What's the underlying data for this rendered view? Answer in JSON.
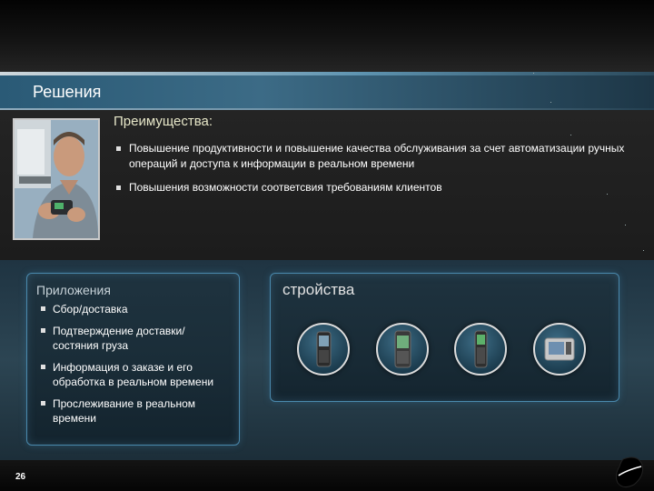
{
  "title": "Решения",
  "advantages": {
    "heading": "Преимущества:",
    "items": [
      "Повышение продуктивности и повышение качества обслуживания за счет автоматизации ручных операций и доступа к информации в реальном времени",
      "Повышения возможности соответсвия требованиям клиентов"
    ]
  },
  "applications": {
    "heading": "Приложения",
    "items": [
      "Сбор/доставка",
      "Подтверждение доставки/состяния груза",
      "Информация о заказе и его обработка в реальном времени",
      "Прослеживание в реальном времени"
    ]
  },
  "devices": {
    "heading": "стройства",
    "icons": [
      "handheld-computer-icon",
      "rugged-pda-icon",
      "handheld-scanner-icon",
      "vehicle-terminal-icon"
    ]
  },
  "footer": {
    "page_number": "26"
  },
  "colors": {
    "title_bar": "#3c6b86",
    "panel_border": "#4a89ad",
    "heading_yellow": "#e6e6c8"
  }
}
